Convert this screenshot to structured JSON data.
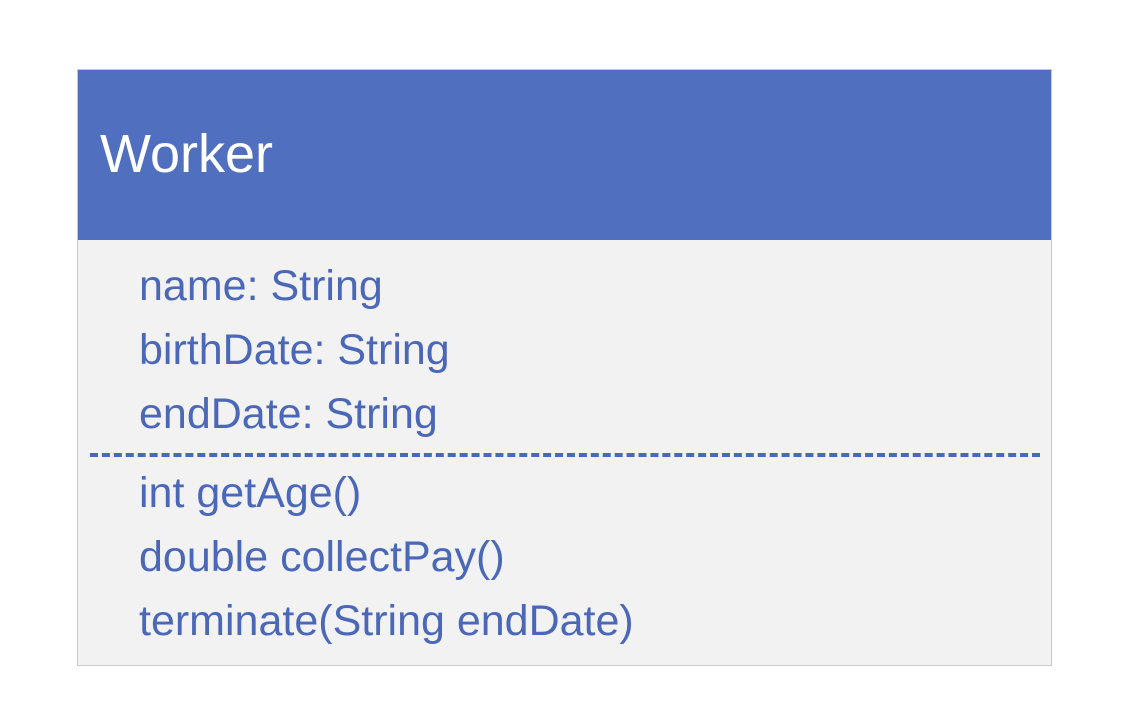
{
  "class_box": {
    "name": "Worker",
    "attributes": [
      "name: String",
      "birthDate: String",
      "endDate: String"
    ],
    "operations": [
      "int getAge()",
      "double collectPay()",
      "terminate(String endDate)"
    ]
  },
  "colors": {
    "header_background": "#5070bf",
    "header_text": "#ffffff",
    "body_background": "#f2f2f2",
    "member_text": "#4a68b7"
  }
}
